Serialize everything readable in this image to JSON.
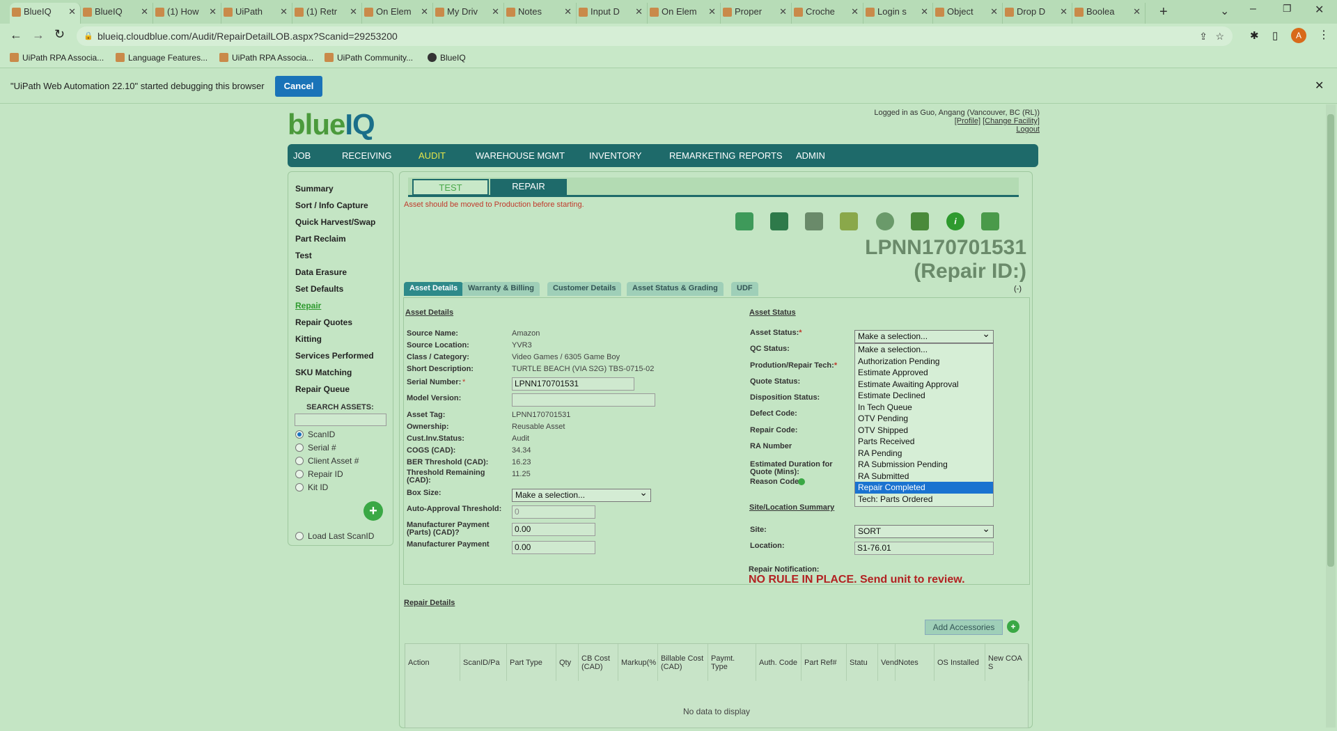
{
  "browser": {
    "tabs": [
      {
        "label": "BlueIQ"
      },
      {
        "label": "BlueIQ"
      },
      {
        "label": "(1) How"
      },
      {
        "label": "UiPath"
      },
      {
        "label": "(1) Retr"
      },
      {
        "label": "On Elem"
      },
      {
        "label": "My Driv"
      },
      {
        "label": "Notes"
      },
      {
        "label": "Input D"
      },
      {
        "label": "On Elem"
      },
      {
        "label": "Proper"
      },
      {
        "label": "Croche"
      },
      {
        "label": "Login s"
      },
      {
        "label": "Object"
      },
      {
        "label": "Drop D"
      },
      {
        "label": "Boolea"
      }
    ],
    "url": "blueiq.cloudblue.com/Audit/RepairDetailLOB.aspx?Scanid=29253200",
    "bookmarks": [
      {
        "label": "UiPath RPA Associa..."
      },
      {
        "label": "Language Features..."
      },
      {
        "label": "UiPath RPA Associa..."
      },
      {
        "label": "UiPath Community..."
      },
      {
        "label": "BlueIQ"
      }
    ],
    "debug_message": "\"UiPath Web Automation 22.10\" started debugging this browser",
    "cancel_label": "Cancel",
    "avatar_letter": "A"
  },
  "header": {
    "logo_a": "blue",
    "logo_b": "IQ",
    "logged_in": "Logged in as Guo, Angang (Vancouver, BC (RL))",
    "profile": "[Profile]",
    "change_facility": "[Change Facility]",
    "logout": "Logout"
  },
  "nav": [
    "JOB",
    "RECEIVING",
    "AUDIT",
    "WAREHOUSE MGMT",
    "INVENTORY",
    "REMARKETING",
    "REPORTS",
    "ADMIN"
  ],
  "sidebar": {
    "items": [
      "Summary",
      "Sort / Info Capture",
      "Quick Harvest/Swap",
      "Part Reclaim",
      "Test",
      "Data Erasure",
      "Set Defaults",
      "Repair",
      "Repair Quotes",
      "Kitting",
      "Services Performed",
      "SKU Matching",
      "Repair Queue"
    ],
    "search_title": "SEARCH ASSETS:",
    "radios": [
      "ScanID",
      "Serial #",
      "Client Asset #",
      "Repair ID",
      "Kit ID"
    ],
    "load_last": "Load Last ScanID"
  },
  "main": {
    "tabs": [
      "TEST",
      "REPAIR"
    ],
    "warning": "Asset should be moved to Production before starting.",
    "lpn": "LPNN170701531",
    "repair_id": "(Repair ID:)",
    "subtabs": [
      "Asset Details",
      "Warranty & Billing",
      "Customer Details",
      "Asset Status & Grading",
      "UDF"
    ],
    "collapse": "(-)",
    "asset_details_title": "Asset Details",
    "fields": [
      {
        "label": "Source Name:",
        "value": "Amazon"
      },
      {
        "label": "Source Location:",
        "value": "YVR3"
      },
      {
        "label": "Class / Category:",
        "value": "Video Games / 6305 Game Boy"
      },
      {
        "label": "Short Description:",
        "value": "TURTLE BEACH (VIA S2G) TBS-0715-02"
      }
    ],
    "serial_label": "Serial Number:",
    "serial_value": "LPNN170701531",
    "model_label": "Model Version:",
    "fields2": [
      {
        "label": "Asset Tag:",
        "value": "LPNN170701531"
      },
      {
        "label": "Ownership:",
        "value": "Reusable Asset"
      },
      {
        "label": "Cust.Inv.Status:",
        "value": "Audit"
      },
      {
        "label": "COGS (CAD):",
        "value": "34.34"
      },
      {
        "label": "BER Threshold (CAD):",
        "value": "16.23"
      }
    ],
    "threshold_remaining_label": "Threshold Remaining (CAD):",
    "threshold_remaining_value": "11.25",
    "box_size_label": "Box Size:",
    "box_size_value": "Make a selection...",
    "auto_approval_label": "Auto-Approval Threshold:",
    "auto_approval_value": "0",
    "mfr_parts_label": "Manufacturer Payment (Parts) (CAD)?",
    "mfr_parts_value": "0.00",
    "mfr_payment_label": "Manufacturer Payment",
    "mfr_payment_value": "0.00",
    "asset_status_title": "Asset Status",
    "status_labels": [
      "Asset Status:",
      "QC Status:",
      "Prodution/Repair Tech:",
      "Quote Status:",
      "Disposition Status:",
      "Defect Code:",
      "Repair Code:",
      "RA Number",
      "Estimated Duration for Quote (Mins):",
      "Reason Code"
    ],
    "asset_status_value": "Make a selection...",
    "dropdown_options": [
      "Make a selection...",
      "Authorization Pending",
      "Estimate Approved",
      "Estimate Awaiting Approval",
      "Estimate Declined",
      "In Tech Queue",
      "OTV Pending",
      "OTV Shipped",
      "Parts Received",
      "RA Pending",
      "RA Submission Pending",
      "RA Submitted",
      "Repair Completed",
      "Tech: Parts Ordered"
    ],
    "dropdown_selected_index": 12,
    "site_summary_title": "Site/Location Summary",
    "site_label": "Site:",
    "site_value": "SORT",
    "location_label": "Location:",
    "location_value": "S1-76.01",
    "repair_notification_label": "Repair Notification:",
    "repair_notification": "NO RULE IN PLACE. Send unit to review.",
    "repair_details_title": "Repair Details",
    "add_accessories": "Add Accessories",
    "grid_headers": [
      "Action",
      "ScanID/Pa",
      "Part Type",
      "Qty",
      "CB Cost (CAD)",
      "Markup(%",
      "Billable Cost (CAD)",
      "Paymt. Type",
      "Auth. Code",
      "Part Ref#",
      "Statu",
      "Vend",
      "Notes",
      "OS Installed",
      "New COA S"
    ],
    "no_data": "No data to display"
  },
  "colors": {
    "nav_bg": "#1e6a6a",
    "warning": "#c0392b",
    "notification": "#b22222",
    "selected_option": "#1a73d0"
  }
}
